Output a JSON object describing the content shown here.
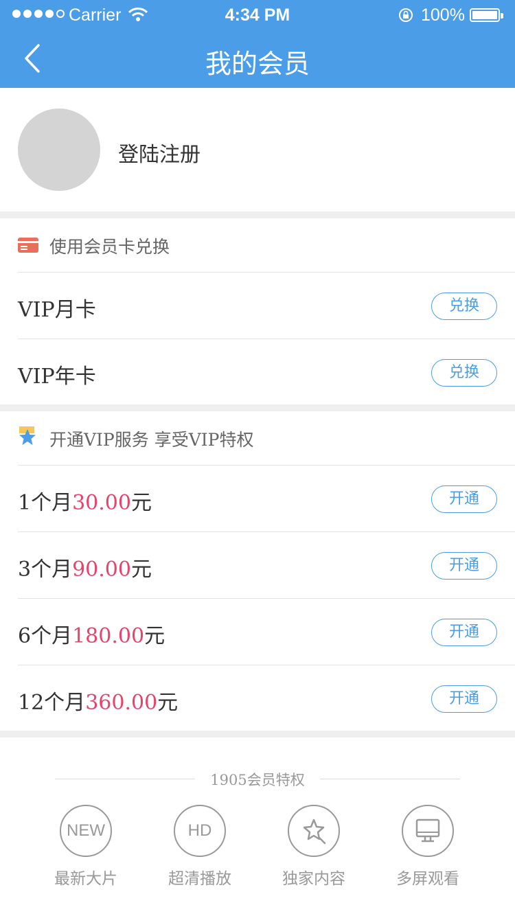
{
  "status_bar": {
    "carrier": "Carrier",
    "time": "4:34 PM",
    "battery": "100%"
  },
  "nav": {
    "title": "我的会员"
  },
  "profile": {
    "login_text": "登陆注册"
  },
  "redeem_section": {
    "header": "使用会员卡兑换",
    "items": [
      {
        "label": "VIP月卡",
        "button": "兑换"
      },
      {
        "label": "VIP年卡",
        "button": "兑换"
      }
    ]
  },
  "vip_section": {
    "header": "开通VIP服务  享受VIP特权",
    "items": [
      {
        "prefix": "1个月",
        "price": "30.00",
        "suffix": "元",
        "button": "开通"
      },
      {
        "prefix": "3个月",
        "price": "90.00",
        "suffix": "元",
        "button": "开通"
      },
      {
        "prefix": "6个月",
        "price": "180.00",
        "suffix": "元",
        "button": "开通"
      },
      {
        "prefix": "12个月",
        "price": "360.00",
        "suffix": "元",
        "button": "开通"
      }
    ]
  },
  "privileges": {
    "title": "1905会员特权",
    "items": [
      {
        "badge": "NEW",
        "label": "最新大片"
      },
      {
        "badge": "HD",
        "label": "超清播放"
      },
      {
        "icon": "star-tag-icon",
        "label": "独家内容"
      },
      {
        "icon": "monitor-icon",
        "label": "多屏观看"
      }
    ]
  },
  "colors": {
    "accent": "#4a9de6",
    "price": "#e8436a",
    "card_icon": "#e8705a"
  }
}
